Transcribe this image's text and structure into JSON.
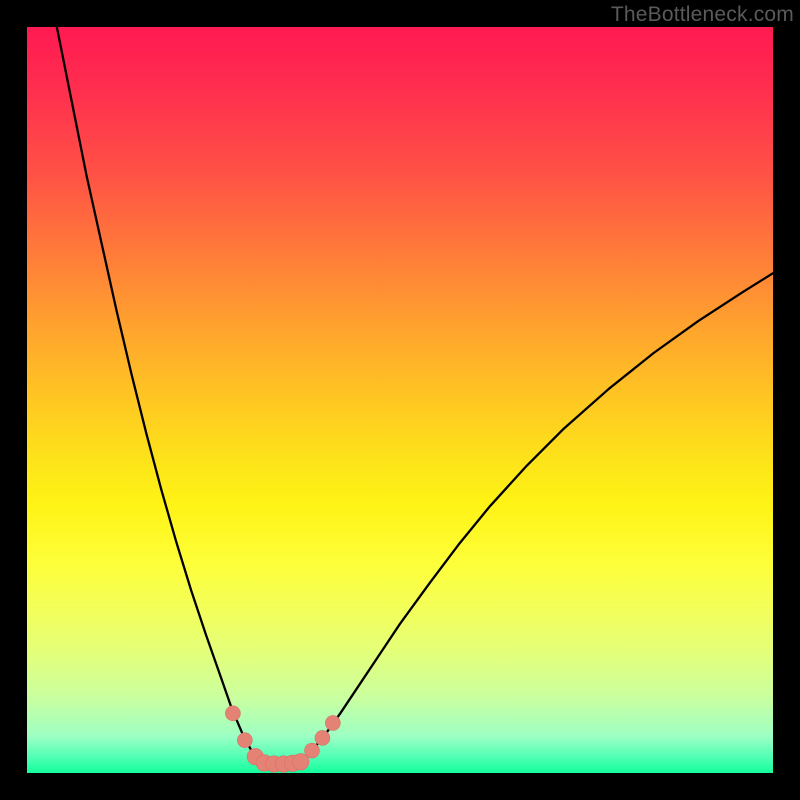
{
  "watermark": "TheBottleneck.com",
  "palette": {
    "marker_fill": "#e58276",
    "marker_stroke": "#d96f65",
    "curve_stroke": "#000000"
  },
  "chart_data": {
    "type": "line",
    "title": "",
    "xlabel": "",
    "ylabel": "",
    "xlim": [
      0,
      100
    ],
    "ylim": [
      0,
      100
    ],
    "note": "Axes are unlabeled in the original image; values are estimated from pixel positions on a 0–100 scale (x left→right, y bottom→top).",
    "series": [
      {
        "name": "left-branch",
        "x": [
          4.0,
          6.0,
          8.0,
          10.0,
          12.0,
          14.0,
          16.0,
          18.0,
          20.0,
          22.0,
          24.0,
          26.0,
          27.5,
          29.0,
          30.3,
          31.3
        ],
        "y": [
          100.0,
          90.0,
          80.0,
          71.0,
          62.0,
          53.5,
          45.5,
          38.0,
          31.0,
          24.5,
          18.5,
          12.8,
          8.5,
          5.0,
          2.6,
          1.5
        ]
      },
      {
        "name": "valley-floor",
        "x": [
          31.3,
          32.0,
          33.0,
          34.0,
          35.0,
          36.0,
          36.8
        ],
        "y": [
          1.5,
          1.3,
          1.2,
          1.15,
          1.2,
          1.3,
          1.5
        ]
      },
      {
        "name": "right-branch",
        "x": [
          36.8,
          38.2,
          40.0,
          42.0,
          44.0,
          47.0,
          50.0,
          54.0,
          58.0,
          62.0,
          67.0,
          72.0,
          78.0,
          84.0,
          90.0,
          96.0,
          100.0
        ],
        "y": [
          1.5,
          3.0,
          5.2,
          8.0,
          11.0,
          15.5,
          20.0,
          25.5,
          30.8,
          35.7,
          41.2,
          46.2,
          51.5,
          56.3,
          60.6,
          64.5,
          67.0
        ]
      }
    ],
    "markers": [
      {
        "x": 27.6,
        "y": 8.0,
        "r": 1.0
      },
      {
        "x": 29.2,
        "y": 4.4,
        "r": 1.0
      },
      {
        "x": 30.6,
        "y": 2.2,
        "r": 1.1
      },
      {
        "x": 31.8,
        "y": 1.35,
        "r": 1.1
      },
      {
        "x": 33.1,
        "y": 1.2,
        "r": 1.1
      },
      {
        "x": 34.4,
        "y": 1.2,
        "r": 1.1
      },
      {
        "x": 35.6,
        "y": 1.3,
        "r": 1.1
      },
      {
        "x": 36.7,
        "y": 1.5,
        "r": 1.1
      },
      {
        "x": 38.2,
        "y": 3.0,
        "r": 1.0
      },
      {
        "x": 39.6,
        "y": 4.7,
        "r": 1.0
      },
      {
        "x": 41.0,
        "y": 6.7,
        "r": 1.0
      }
    ]
  }
}
